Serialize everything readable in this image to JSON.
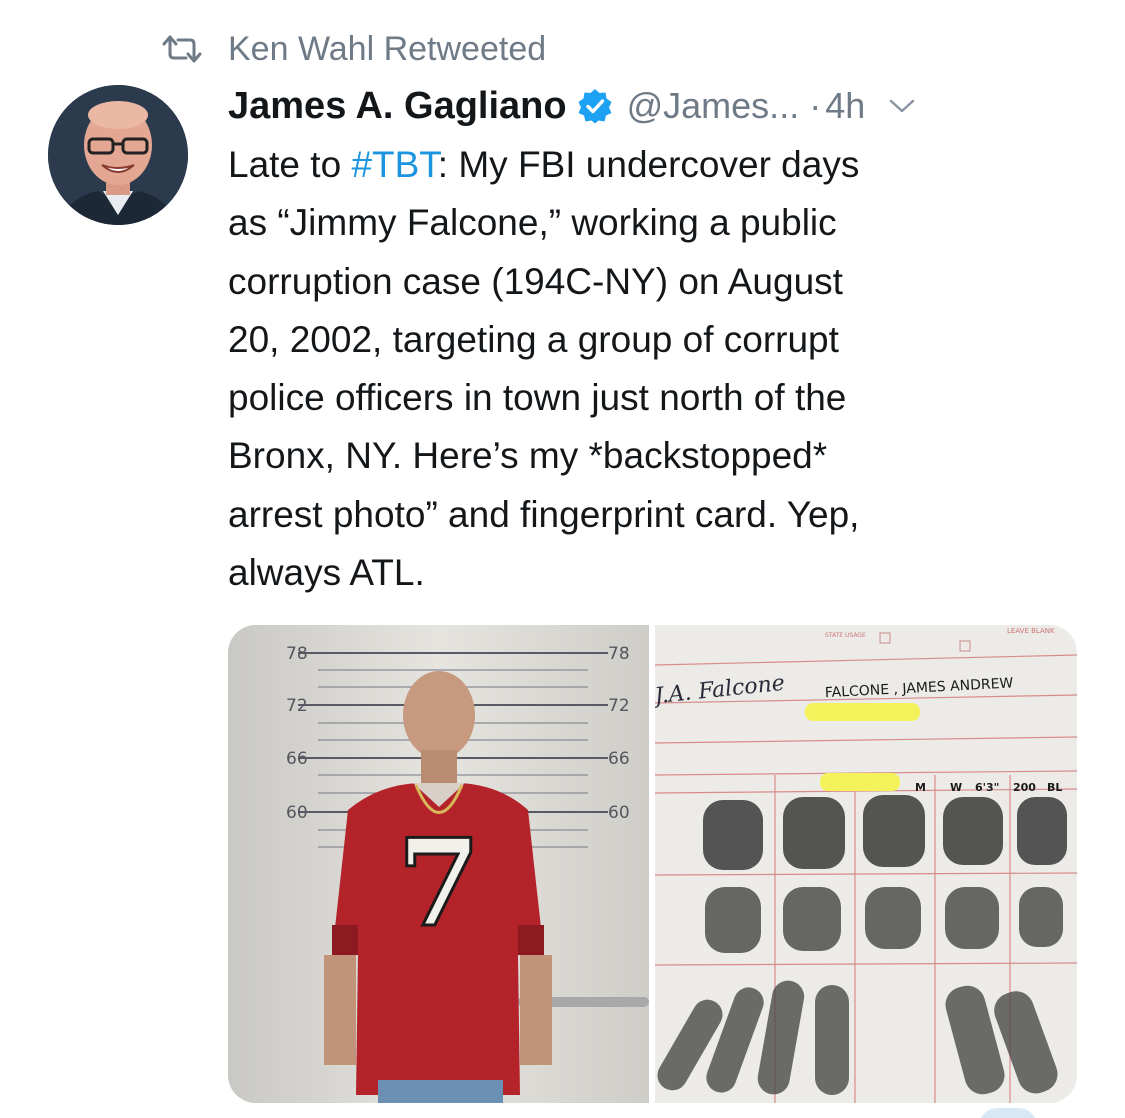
{
  "retweet_context": {
    "label": "Ken Wahl Retweeted",
    "icon": "retweet-icon"
  },
  "tweet": {
    "author": {
      "display_name": "James A. Gagliano",
      "handle": "@James...",
      "verified": true
    },
    "separator": "·",
    "time": "4h",
    "text_lines": [
      {
        "before": "Late to ",
        "hashtag": "#TBT",
        "after": ": My FBI undercover days"
      },
      {
        "text": "as “Jimmy Falcone,” working a public"
      },
      {
        "text": "corruption case (194C-NY) on August"
      },
      {
        "text": "20, 2002, targeting a group of corrupt"
      },
      {
        "text": "police officers  in town just north of the"
      },
      {
        "text": "Bronx, NY. Here’s my *backstopped*"
      },
      {
        "text": "arrest photo” and fingerprint card. Yep,"
      },
      {
        "text": "always ATL."
      }
    ]
  },
  "media": {
    "mugshot": {
      "height_marks": [
        "78",
        "72",
        "66",
        "60"
      ],
      "jersey_number": "7"
    },
    "fingerprint_card": {
      "name_field": "FALCONE , JAMES ANDREW",
      "signature": "J.A. Falcone",
      "sex": "M",
      "race": "W",
      "height": "6'3\"",
      "weight": "200",
      "eyes": "BL",
      "leave_blank": "LEAVE BLANK",
      "state_usage": "STATE USAGE"
    }
  },
  "colors": {
    "text_primary": "#14171a",
    "text_secondary": "#6e7a86",
    "link": "#1b95e0",
    "verified": "#1da1f2",
    "jersey_red": "#b5232a",
    "highlight_yellow": "#f3f25a"
  }
}
